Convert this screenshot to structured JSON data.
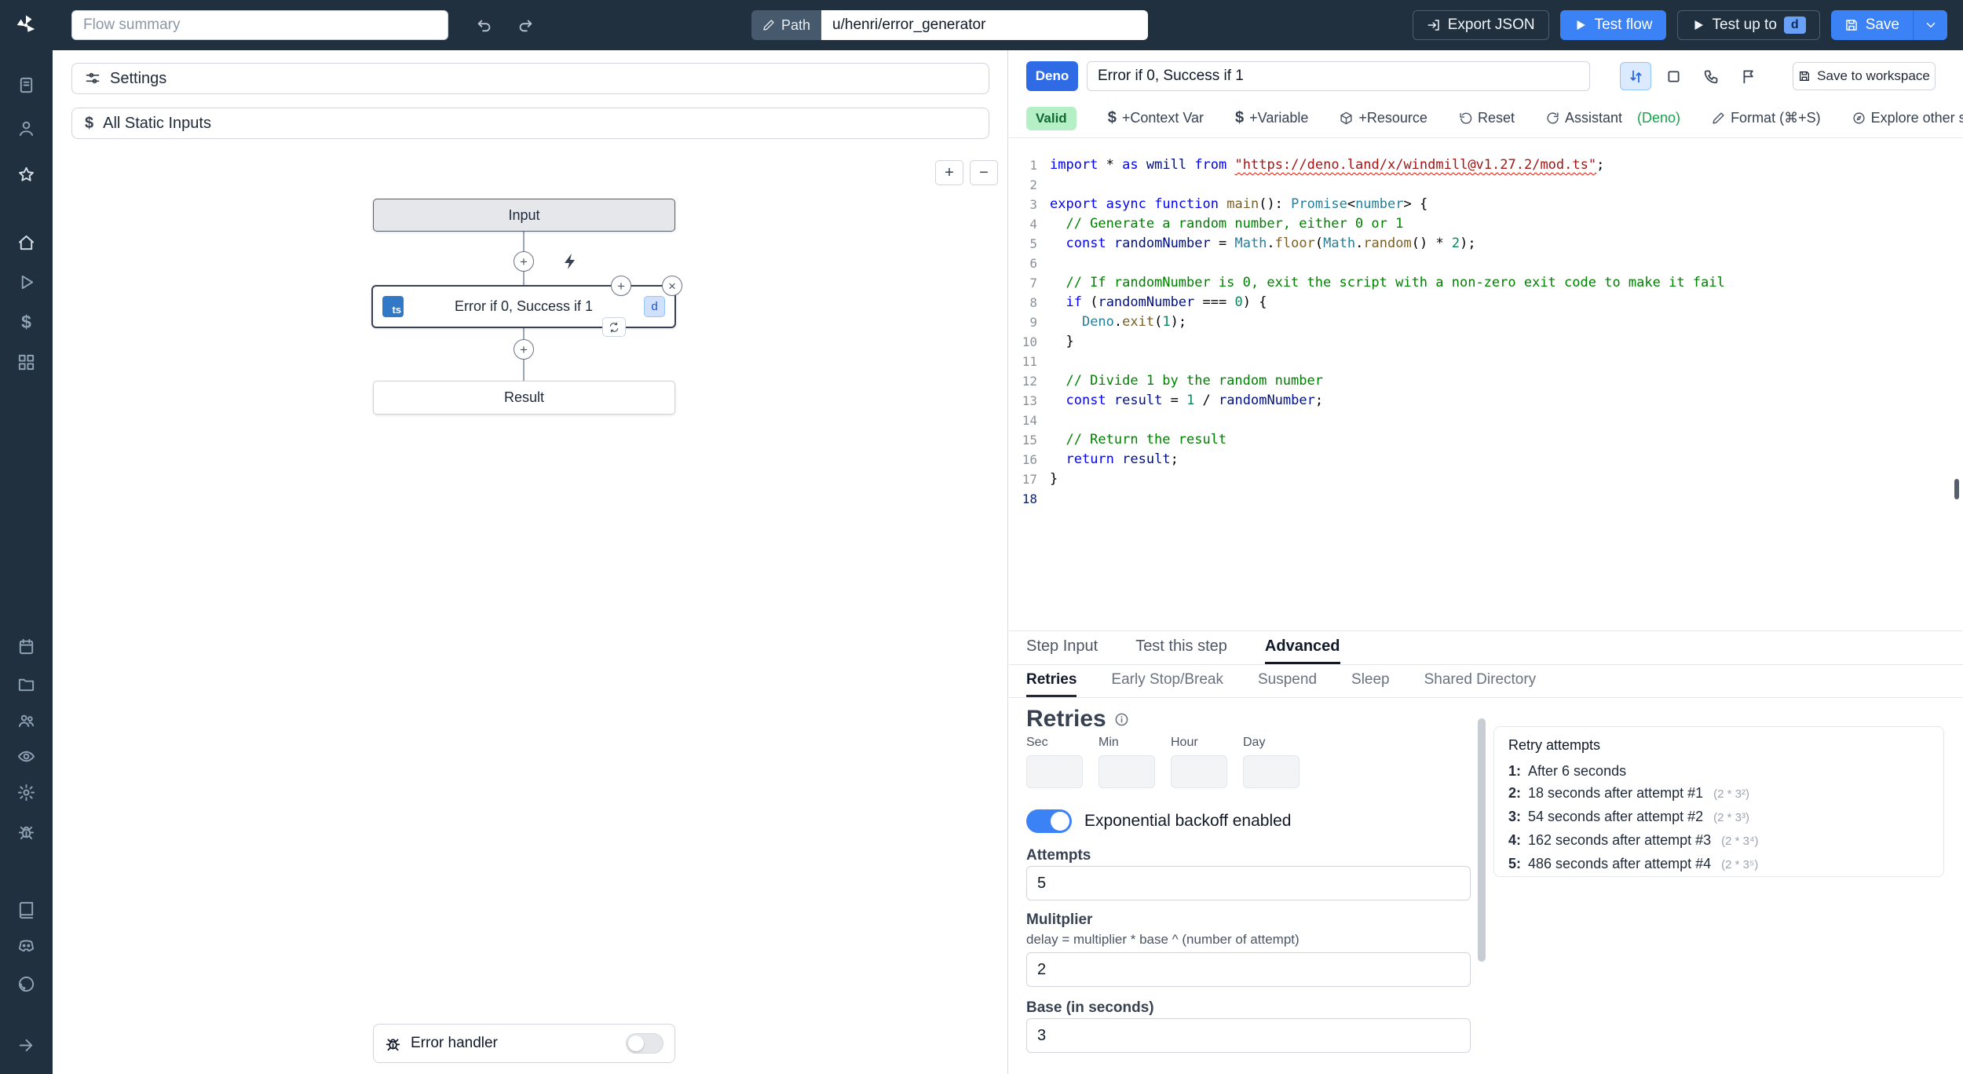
{
  "colors": {
    "primary": "#3b82f6",
    "topbar": "#20303f",
    "valid_bg": "#b4efc5",
    "assistant_green": "#16a34a",
    "ts_badge": "#3178c6"
  },
  "glyphs": {
    "plus": "+",
    "minus": "−",
    "close": "×"
  },
  "topbar": {
    "flow_summary": "Flow summary",
    "path_label": "Path",
    "path_value": "u/henri/error_generator",
    "export_json_label": "Export JSON",
    "test_flow_label": "Test flow",
    "test_up_to_label": "Test up to",
    "test_up_to_badge": "d",
    "save_label": "Save"
  },
  "sidebar": {
    "icon_names": [
      "scripts",
      "account",
      "favorites",
      "home",
      "runs",
      "variables",
      "resources",
      "schedules",
      "folders",
      "groups",
      "audit-logs",
      "settings",
      "workers",
      "docs",
      "discord",
      "github",
      "collapse"
    ]
  },
  "flow": {
    "settings_label": "Settings",
    "static_inputs_label": "All Static Inputs",
    "input_node": "Input",
    "step_lang": "ts",
    "step_title": "Error if 0, Success if 1",
    "step_badge": "d",
    "result_node": "Result",
    "error_handler_label": "Error handler"
  },
  "script_header": {
    "lang_badge": "Deno",
    "name": "Error if 0, Success if 1",
    "save_to_workspace": "Save to workspace"
  },
  "toolbar": {
    "valid": "Valid",
    "context_var": "+Context Var",
    "variable": "+Variable",
    "resource": "+Resource",
    "reset": "Reset",
    "assistant": "Assistant",
    "assistant_lang": "(Deno)",
    "format": "Format (⌘+S)",
    "explore": "Explore other s"
  },
  "editor": {
    "active_line": 18,
    "lines": [
      [
        [
          "k",
          "import"
        ],
        [
          "p",
          " * "
        ],
        [
          "k",
          "as"
        ],
        [
          "p",
          " "
        ],
        [
          "d",
          "wmill"
        ],
        [
          "p",
          " "
        ],
        [
          "k",
          "from"
        ],
        [
          "p",
          " "
        ],
        [
          "su",
          "\"https://deno.land/x/windmill@v1.27.2/mod.ts\""
        ],
        [
          "p",
          ";"
        ]
      ],
      [],
      [
        [
          "k",
          "export"
        ],
        [
          "p",
          " "
        ],
        [
          "k",
          "async"
        ],
        [
          "p",
          " "
        ],
        [
          "k",
          "function"
        ],
        [
          "p",
          " "
        ],
        [
          "f",
          "main"
        ],
        [
          "p",
          "(): "
        ],
        [
          "t",
          "Promise"
        ],
        [
          "p",
          "<"
        ],
        [
          "t",
          "number"
        ],
        [
          "p",
          "> {"
        ]
      ],
      [
        [
          "c",
          "  // Generate a random number, either 0 or 1"
        ]
      ],
      [
        [
          "p",
          "  "
        ],
        [
          "k",
          "const"
        ],
        [
          "p",
          " "
        ],
        [
          "d",
          "randomNumber"
        ],
        [
          "p",
          " = "
        ],
        [
          "t",
          "Math"
        ],
        [
          "p",
          "."
        ],
        [
          "f",
          "floor"
        ],
        [
          "p",
          "("
        ],
        [
          "t",
          "Math"
        ],
        [
          "p",
          "."
        ],
        [
          "f",
          "random"
        ],
        [
          "p",
          "() * "
        ],
        [
          "n",
          "2"
        ],
        [
          "p",
          ");"
        ]
      ],
      [],
      [
        [
          "c",
          "  // If randomNumber is 0, exit the script with a non-zero exit code to make it fail"
        ]
      ],
      [
        [
          "p",
          "  "
        ],
        [
          "k",
          "if"
        ],
        [
          "p",
          " ("
        ],
        [
          "d",
          "randomNumber"
        ],
        [
          "p",
          " === "
        ],
        [
          "n",
          "0"
        ],
        [
          "p",
          ") {"
        ]
      ],
      [
        [
          "p",
          "    "
        ],
        [
          "t",
          "Deno"
        ],
        [
          "p",
          "."
        ],
        [
          "f",
          "exit"
        ],
        [
          "p",
          "("
        ],
        [
          "n",
          "1"
        ],
        [
          "p",
          ");"
        ]
      ],
      [
        [
          "p",
          "  }"
        ]
      ],
      [],
      [
        [
          "c",
          "  // Divide 1 by the random number"
        ]
      ],
      [
        [
          "p",
          "  "
        ],
        [
          "k",
          "const"
        ],
        [
          "p",
          " "
        ],
        [
          "d",
          "result"
        ],
        [
          "p",
          " = "
        ],
        [
          "n",
          "1"
        ],
        [
          "p",
          " / "
        ],
        [
          "d",
          "randomNumber"
        ],
        [
          "p",
          ";"
        ]
      ],
      [],
      [
        [
          "c",
          "  // Return the result"
        ]
      ],
      [
        [
          "p",
          "  "
        ],
        [
          "k",
          "return"
        ],
        [
          "p",
          " "
        ],
        [
          "d",
          "result"
        ],
        [
          "p",
          ";"
        ]
      ],
      [
        [
          "p",
          "}"
        ]
      ],
      []
    ]
  },
  "tabs": {
    "main": [
      "Step Input",
      "Test this step",
      "Advanced"
    ],
    "main_active": 2,
    "sub": [
      "Retries",
      "Early Stop/Break",
      "Suspend",
      "Sleep",
      "Shared Directory"
    ],
    "sub_active": 0
  },
  "retries": {
    "title": "Retries",
    "time_fields": [
      "Sec",
      "Min",
      "Hour",
      "Day"
    ],
    "backoff_label": "Exponential backoff enabled",
    "attempts_label": "Attempts",
    "attempts_value": "5",
    "multiplier_label": "Mulitplier",
    "multiplier_help": "delay = multiplier * base ^ (number of attempt)",
    "multiplier_value": "2",
    "base_label": "Base (in seconds)",
    "base_value": "3",
    "panel_title": "Retry attempts",
    "attempts": [
      {
        "n": "1:",
        "text": "After 6 seconds",
        "formula": ""
      },
      {
        "n": "2:",
        "text": "18 seconds after attempt #1",
        "formula": "(2 * 3²)"
      },
      {
        "n": "3:",
        "text": "54 seconds after attempt #2",
        "formula": "(2 * 3³)"
      },
      {
        "n": "4:",
        "text": "162 seconds after attempt #3",
        "formula": "(2 * 3⁴)"
      },
      {
        "n": "5:",
        "text": "486 seconds after attempt #4",
        "formula": "(2 * 3⁵)"
      }
    ]
  }
}
